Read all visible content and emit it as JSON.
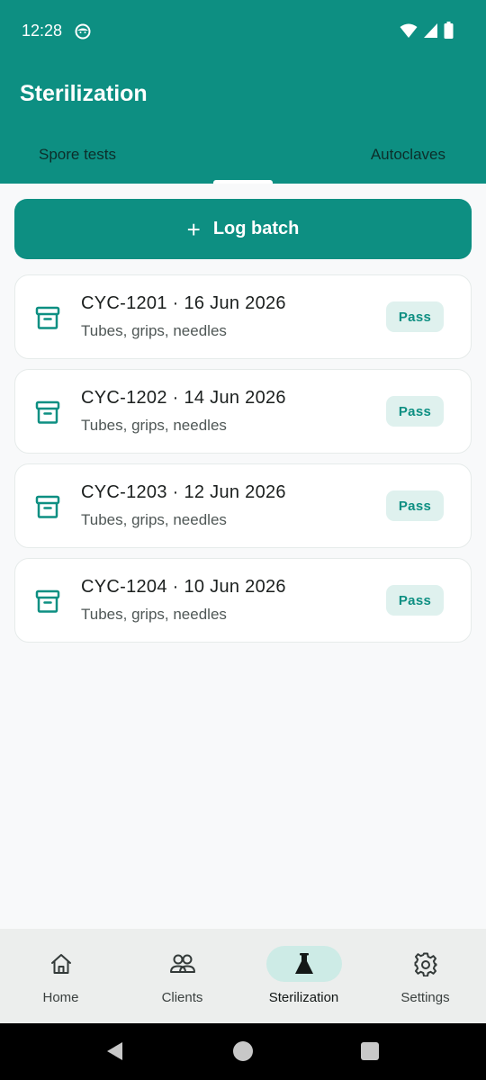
{
  "status_bar": {
    "time": "12:28",
    "icons": [
      "face-icon",
      "wifi-icon",
      "signal-icon",
      "battery-icon"
    ]
  },
  "header": {
    "title": "Sterilization",
    "tabs": [
      {
        "label": "Spore tests",
        "selected": false
      },
      {
        "label": "Autoclaves",
        "selected": false
      }
    ]
  },
  "actions": {
    "log_batch_label": "Log batch",
    "log_batch_icon": "plus-icon"
  },
  "cycles": [
    {
      "title": "CYC-1201 · 16 Jun 2026",
      "subtitle": "Tubes, grips, needles",
      "status": "Pass",
      "icon": "archive-box-icon"
    },
    {
      "title": "CYC-1202 · 14 Jun 2026",
      "subtitle": "Tubes, grips, needles",
      "status": "Pass",
      "icon": "archive-box-icon"
    },
    {
      "title": "CYC-1203 · 12 Jun 2026",
      "subtitle": "Tubes, grips, needles",
      "status": "Pass",
      "icon": "archive-box-icon"
    },
    {
      "title": "CYC-1204 · 10 Jun 2026",
      "subtitle": "Tubes, grips, needles",
      "status": "Pass",
      "icon": "archive-box-icon"
    }
  ],
  "bottom_nav": {
    "items": [
      {
        "label": "Home",
        "icon": "home-icon",
        "active": false
      },
      {
        "label": "Clients",
        "icon": "people-icon",
        "active": false
      },
      {
        "label": "Sterilization",
        "icon": "flask-icon",
        "active": true
      },
      {
        "label": "Settings",
        "icon": "gear-icon",
        "active": false
      }
    ]
  },
  "system_nav": {
    "buttons": [
      "back-icon",
      "home-circle-icon",
      "recents-icon"
    ]
  },
  "colors": {
    "primary": "#0d8f82",
    "badge_bg": "#dff1ee",
    "active_nav_pill": "#cdebe6",
    "background": "#f8f9fa"
  }
}
